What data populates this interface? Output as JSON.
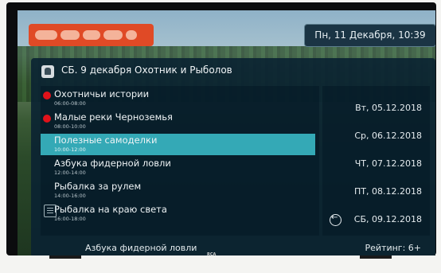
{
  "status_bar": {
    "datetime": "Пн, 11 Декабря, 10:39"
  },
  "header": {
    "title": "СБ. 9 декабря Охотник и Рыболов"
  },
  "programs": [
    {
      "title": "Охотничьи истории",
      "time": "06:00-08:00",
      "recorded": true,
      "selected": false
    },
    {
      "title": "Малые реки Черноземья",
      "time": "08:00-10:00",
      "recorded": true,
      "selected": false
    },
    {
      "title": "Полезные самоделки",
      "time": "10:00-12:00",
      "recorded": false,
      "selected": true
    },
    {
      "title": "Азбука фидерной ловли",
      "time": "12:00-14:00",
      "recorded": false,
      "selected": false
    },
    {
      "title": "Рыбалка за рулем",
      "time": "14:00-16:00",
      "recorded": false,
      "selected": false
    },
    {
      "title": "Рыбалка на краю света",
      "time": "16:00-18:00",
      "recorded": false,
      "selected": false
    }
  ],
  "dates": [
    "Вт, 05.12.2018",
    "Ср, 06.12.2018",
    "ЧТ, 07.12.2018",
    "ПТ, 08.12.2018",
    "СБ, 09.12.2018"
  ],
  "footer": {
    "title": "Азбука фидерной ловли",
    "rating": "Рейтинг: 6+"
  },
  "tv_brand": "RCA",
  "colors": {
    "logo": "#e04a26",
    "selection": "#34a9b6",
    "record_dot": "#e0121a",
    "panel": "#0a2232"
  }
}
